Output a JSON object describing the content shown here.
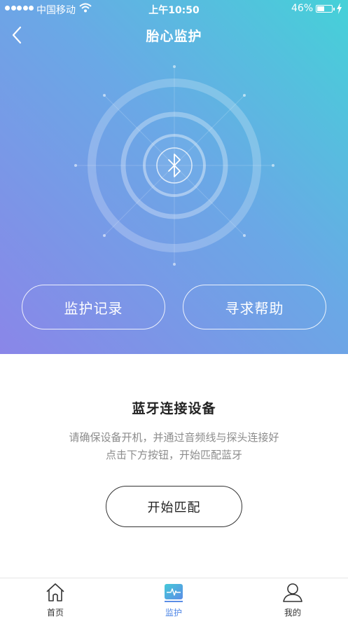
{
  "status_bar": {
    "carrier": "中国移动",
    "time": "上午10:50",
    "battery": "46%"
  },
  "header": {
    "title": "胎心监护"
  },
  "hero": {
    "center_icon": "bluetooth-icon",
    "left_button": "监护记录",
    "right_button": "寻求帮助"
  },
  "connect": {
    "title": "蓝牙连接设备",
    "desc_line1": "请确保设备开机，并通过音频线与探头连接好",
    "desc_line2": "点击下方按钮，开始匹配蓝牙",
    "button": "开始匹配"
  },
  "tab_bar": {
    "items": [
      {
        "label": "首页",
        "icon": "home-icon"
      },
      {
        "label": "监护",
        "icon": "heartbeat-icon"
      },
      {
        "label": "我的",
        "icon": "user-icon"
      }
    ],
    "active_color": "#4e86e6"
  },
  "colors": {
    "gradient_start": "#45d1d8",
    "gradient_end": "#8a86e8"
  }
}
